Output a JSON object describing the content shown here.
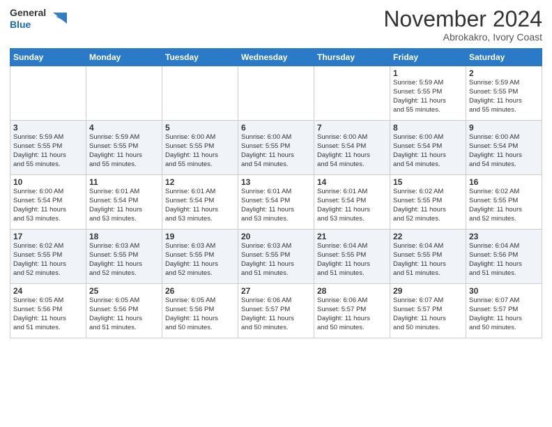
{
  "header": {
    "logo_line1": "General",
    "logo_line2": "Blue",
    "month": "November 2024",
    "location": "Abrokakro, Ivory Coast"
  },
  "weekdays": [
    "Sunday",
    "Monday",
    "Tuesday",
    "Wednesday",
    "Thursday",
    "Friday",
    "Saturday"
  ],
  "weeks": [
    [
      {
        "day": "",
        "info": ""
      },
      {
        "day": "",
        "info": ""
      },
      {
        "day": "",
        "info": ""
      },
      {
        "day": "",
        "info": ""
      },
      {
        "day": "",
        "info": ""
      },
      {
        "day": "1",
        "info": "Sunrise: 5:59 AM\nSunset: 5:55 PM\nDaylight: 11 hours\nand 55 minutes."
      },
      {
        "day": "2",
        "info": "Sunrise: 5:59 AM\nSunset: 5:55 PM\nDaylight: 11 hours\nand 55 minutes."
      }
    ],
    [
      {
        "day": "3",
        "info": "Sunrise: 5:59 AM\nSunset: 5:55 PM\nDaylight: 11 hours\nand 55 minutes."
      },
      {
        "day": "4",
        "info": "Sunrise: 5:59 AM\nSunset: 5:55 PM\nDaylight: 11 hours\nand 55 minutes."
      },
      {
        "day": "5",
        "info": "Sunrise: 6:00 AM\nSunset: 5:55 PM\nDaylight: 11 hours\nand 55 minutes."
      },
      {
        "day": "6",
        "info": "Sunrise: 6:00 AM\nSunset: 5:55 PM\nDaylight: 11 hours\nand 54 minutes."
      },
      {
        "day": "7",
        "info": "Sunrise: 6:00 AM\nSunset: 5:54 PM\nDaylight: 11 hours\nand 54 minutes."
      },
      {
        "day": "8",
        "info": "Sunrise: 6:00 AM\nSunset: 5:54 PM\nDaylight: 11 hours\nand 54 minutes."
      },
      {
        "day": "9",
        "info": "Sunrise: 6:00 AM\nSunset: 5:54 PM\nDaylight: 11 hours\nand 54 minutes."
      }
    ],
    [
      {
        "day": "10",
        "info": "Sunrise: 6:00 AM\nSunset: 5:54 PM\nDaylight: 11 hours\nand 53 minutes."
      },
      {
        "day": "11",
        "info": "Sunrise: 6:01 AM\nSunset: 5:54 PM\nDaylight: 11 hours\nand 53 minutes."
      },
      {
        "day": "12",
        "info": "Sunrise: 6:01 AM\nSunset: 5:54 PM\nDaylight: 11 hours\nand 53 minutes."
      },
      {
        "day": "13",
        "info": "Sunrise: 6:01 AM\nSunset: 5:54 PM\nDaylight: 11 hours\nand 53 minutes."
      },
      {
        "day": "14",
        "info": "Sunrise: 6:01 AM\nSunset: 5:54 PM\nDaylight: 11 hours\nand 53 minutes."
      },
      {
        "day": "15",
        "info": "Sunrise: 6:02 AM\nSunset: 5:55 PM\nDaylight: 11 hours\nand 52 minutes."
      },
      {
        "day": "16",
        "info": "Sunrise: 6:02 AM\nSunset: 5:55 PM\nDaylight: 11 hours\nand 52 minutes."
      }
    ],
    [
      {
        "day": "17",
        "info": "Sunrise: 6:02 AM\nSunset: 5:55 PM\nDaylight: 11 hours\nand 52 minutes."
      },
      {
        "day": "18",
        "info": "Sunrise: 6:03 AM\nSunset: 5:55 PM\nDaylight: 11 hours\nand 52 minutes."
      },
      {
        "day": "19",
        "info": "Sunrise: 6:03 AM\nSunset: 5:55 PM\nDaylight: 11 hours\nand 52 minutes."
      },
      {
        "day": "20",
        "info": "Sunrise: 6:03 AM\nSunset: 5:55 PM\nDaylight: 11 hours\nand 51 minutes."
      },
      {
        "day": "21",
        "info": "Sunrise: 6:04 AM\nSunset: 5:55 PM\nDaylight: 11 hours\nand 51 minutes."
      },
      {
        "day": "22",
        "info": "Sunrise: 6:04 AM\nSunset: 5:55 PM\nDaylight: 11 hours\nand 51 minutes."
      },
      {
        "day": "23",
        "info": "Sunrise: 6:04 AM\nSunset: 5:56 PM\nDaylight: 11 hours\nand 51 minutes."
      }
    ],
    [
      {
        "day": "24",
        "info": "Sunrise: 6:05 AM\nSunset: 5:56 PM\nDaylight: 11 hours\nand 51 minutes."
      },
      {
        "day": "25",
        "info": "Sunrise: 6:05 AM\nSunset: 5:56 PM\nDaylight: 11 hours\nand 51 minutes."
      },
      {
        "day": "26",
        "info": "Sunrise: 6:05 AM\nSunset: 5:56 PM\nDaylight: 11 hours\nand 50 minutes."
      },
      {
        "day": "27",
        "info": "Sunrise: 6:06 AM\nSunset: 5:57 PM\nDaylight: 11 hours\nand 50 minutes."
      },
      {
        "day": "28",
        "info": "Sunrise: 6:06 AM\nSunset: 5:57 PM\nDaylight: 11 hours\nand 50 minutes."
      },
      {
        "day": "29",
        "info": "Sunrise: 6:07 AM\nSunset: 5:57 PM\nDaylight: 11 hours\nand 50 minutes."
      },
      {
        "day": "30",
        "info": "Sunrise: 6:07 AM\nSunset: 5:57 PM\nDaylight: 11 hours\nand 50 minutes."
      }
    ]
  ]
}
